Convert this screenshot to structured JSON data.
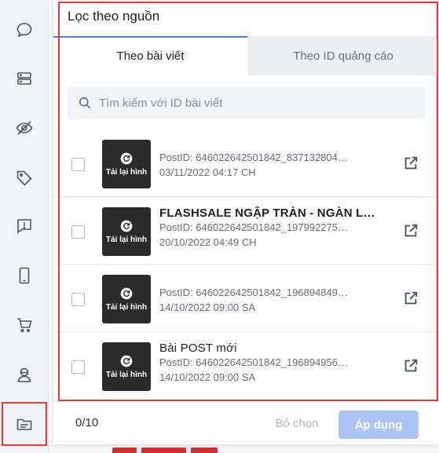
{
  "rail": {
    "icons": [
      "chat-icon",
      "server-icon",
      "eye-off-icon",
      "tag-icon",
      "report-chat-icon",
      "phone-icon",
      "cart-icon",
      "agent-icon",
      "folder-icon"
    ]
  },
  "panel": {
    "title": "Lọc theo nguồn",
    "tabs": [
      {
        "label": "Theo bài viết",
        "active": true
      },
      {
        "label": "Theo ID quảng cáo",
        "active": false
      }
    ],
    "search": {
      "placeholder": "Tìm kiếm với ID bài viết",
      "value": ""
    },
    "posts": [
      {
        "title": "",
        "id": "PostID: 646022642501842_837132804…",
        "date": "03/11/2022 04:17 CH",
        "thumb_label": "Tải lại hình",
        "checked": false
      },
      {
        "title": "FLASHSALE NGẬP TRÀN - NGÀN LỚI …",
        "id": "PostID: 646022642501842_197992275…",
        "date": "20/10/2022 04:49 CH",
        "thumb_label": "Tải lại hình",
        "checked": false
      },
      {
        "title": "",
        "id": "PostID: 646022642501842_196894849…",
        "date": "14/10/2022 09:00 SA",
        "thumb_label": "Tải lại hình",
        "checked": false
      },
      {
        "title": "Bài POST mới",
        "id": "PostID: 646022642501842_196894956…",
        "date": "14/10/2022 09:00 SA",
        "thumb_label": "Tải lại hình",
        "checked": false
      }
    ],
    "footer": {
      "count": "0/10",
      "clear_label": "Bỏ chọn",
      "apply_label": "Áp dụng"
    }
  },
  "colors": {
    "accent": "#4c7be0",
    "highlight": "#e53935",
    "apply_disabled": "#a9c4f5"
  }
}
